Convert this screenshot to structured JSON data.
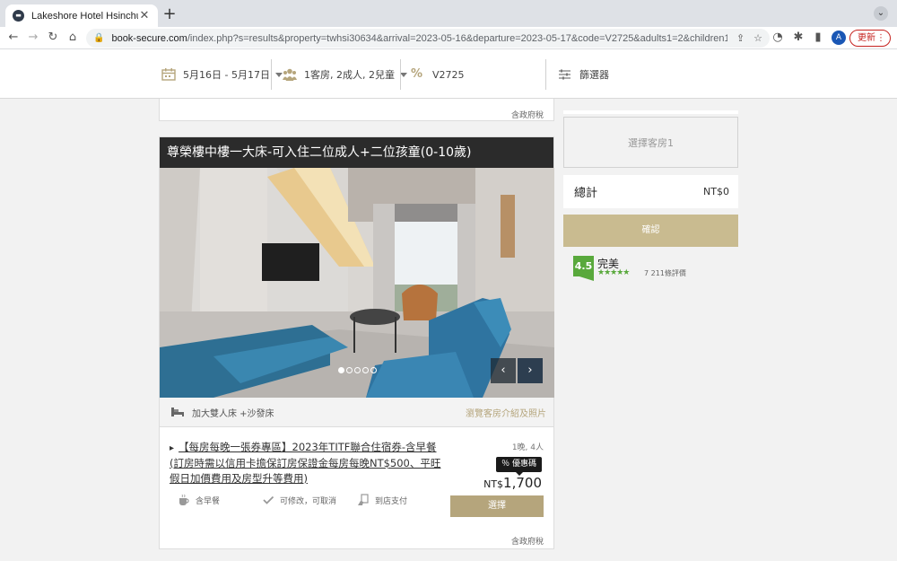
{
  "browser": {
    "tab_title": "Lakeshore Hotel Hsinchu",
    "url_host": "book-secure.com",
    "url_path": "/index.php?s=results&property=twhsi30634&arrival=2023-05-16&departure=2023-05-17&code=V2725&adults1=2&children1=2...",
    "update_label": "更新",
    "avatar_letter": "A"
  },
  "filters": {
    "dates": "5月16日 - 5月17日",
    "guests": "1客房, 2成人, 2兒童",
    "code": "V2725",
    "filter_label": "篩選器"
  },
  "colors": {
    "accent_gold": "#b5a57c",
    "title_bar": "#2b2b2b",
    "rating_green": "#59a93c"
  },
  "previous_card": {
    "tax_note": "含政府稅"
  },
  "room": {
    "title": "尊榮樓中樓一大床-可入住二位成人+二位孩童(0-10歲)",
    "bed": "加大雙人床 +沙發床",
    "view_link": "瀏覽客房介紹及照片",
    "carousel_total": 5,
    "carousel_active": 1,
    "prev_icon": "‹",
    "next_icon": "›",
    "rate": {
      "name": "【每房每晚一張券專區】2023年TITF聯合住宿券-含早餐(訂房時需以信用卡擔保訂房保證金每房每晚NT$500、平旺假日加價費用及房型升等費用)",
      "occupancy": "1晚, 4人",
      "promo": "％ 優惠碼",
      "currency": "NT$",
      "price": "1,700",
      "select_label": "選擇",
      "features": [
        "含早餐",
        "可修改，可取消",
        "到店支付"
      ],
      "tax_note": "含政府稅"
    }
  },
  "sidebar": {
    "room_slot": "選擇客房1",
    "total_label": "總計",
    "total_amount": "NT$0",
    "confirm_label": "確認",
    "score": "4.5",
    "score_word": "完美",
    "stars": "★★★★★",
    "reviews": "7 211條評價"
  }
}
